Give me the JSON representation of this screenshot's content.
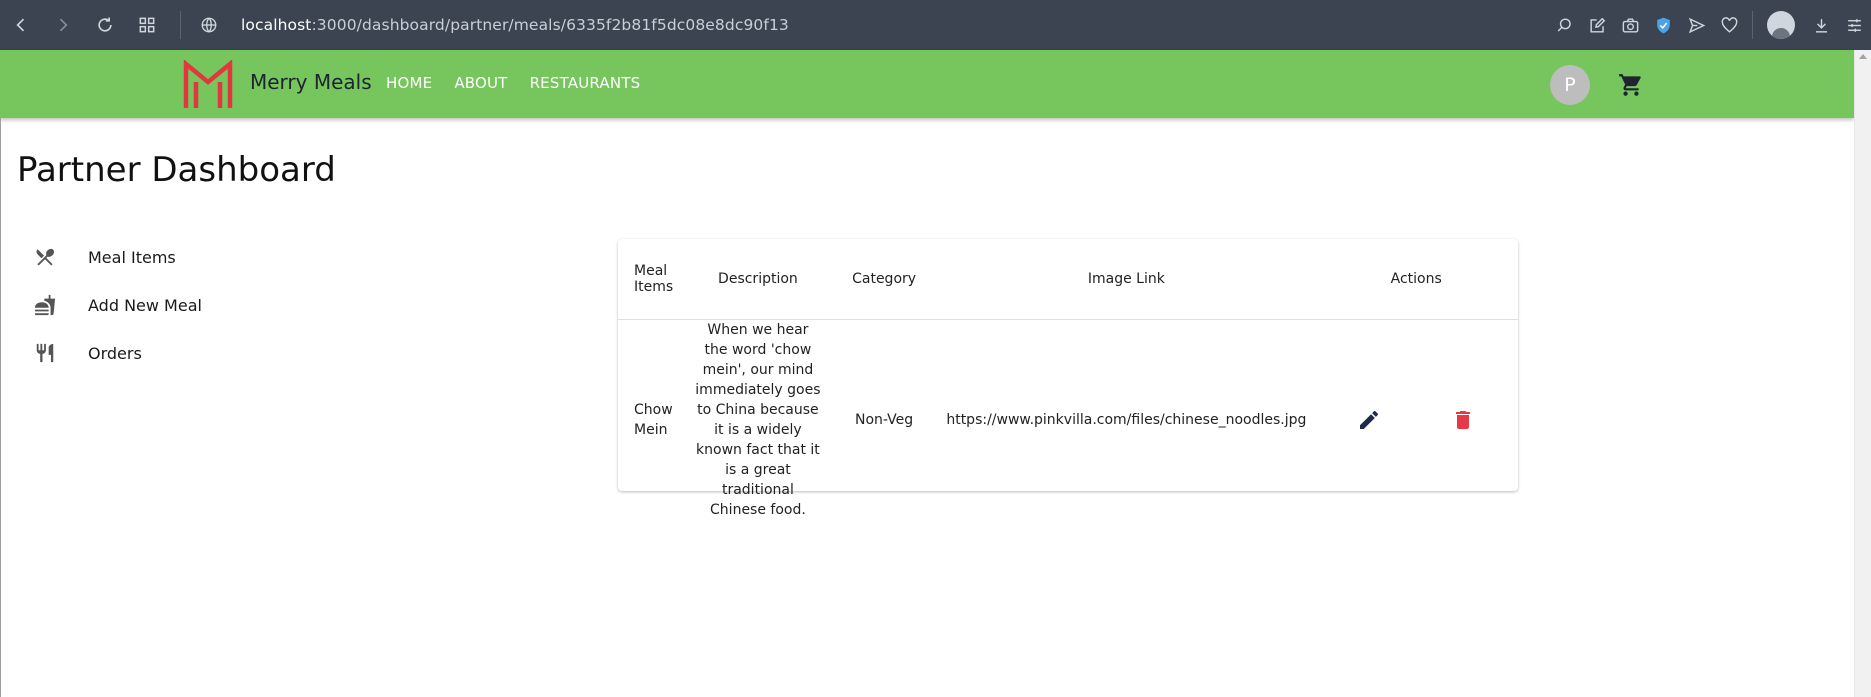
{
  "browser": {
    "url_host": "localhost",
    "url_path": ":3000/dashboard/partner/meals/6335f2b81f5dc08e8dc90f13"
  },
  "header": {
    "brand": "Merry Meals",
    "nav": [
      "HOME",
      "ABOUT",
      "RESTAURANTS"
    ],
    "avatar_initial": "P",
    "colors": {
      "bar": "#76c55d",
      "logo": "#e0383e"
    }
  },
  "page": {
    "title": "Partner Dashboard"
  },
  "sidebar": {
    "items": [
      {
        "label": "Meal Items",
        "icon": "utensils-crossed-icon"
      },
      {
        "label": "Add New Meal",
        "icon": "fastfood-icon"
      },
      {
        "label": "Orders",
        "icon": "restaurant-icon"
      }
    ]
  },
  "table": {
    "headers": [
      "Meal Items",
      "Description",
      "Category",
      "Image Link",
      "Actions"
    ],
    "rows": [
      {
        "meal": "Chow Mein",
        "description": "When we hear the word 'chow mein', our mind immediately goes to China because it is a widely known fact that it is a great traditional Chinese food.",
        "category": "Non-Veg",
        "image_link": "https://www.pinkvilla.com/files/chinese_noodles.jpg"
      }
    ],
    "action_icons": [
      "edit-icon",
      "delete-icon"
    ],
    "colors": {
      "edit": "#1e2a4a",
      "delete": "#e53945"
    }
  }
}
